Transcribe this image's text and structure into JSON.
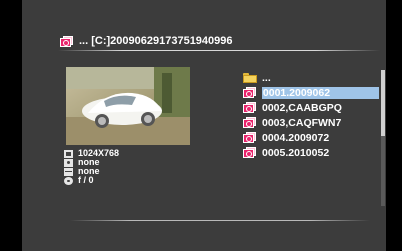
{
  "header": {
    "icon": "photo-icon",
    "path": "... [C:]20090629173751940996"
  },
  "preview": {
    "description_icon": "car-photo-thumbnail"
  },
  "info": {
    "resolution": "1024X768",
    "camera": "none",
    "date": "none",
    "aperture": "f / 0"
  },
  "file_list": {
    "items": [
      {
        "label": "...",
        "icon": "folder-icon",
        "selected": false
      },
      {
        "label": "0001.2009062",
        "icon": "photo-icon",
        "selected": true
      },
      {
        "label": "0002,CAABGPQ",
        "icon": "photo-icon",
        "selected": false
      },
      {
        "label": "0003,CAQFWN7",
        "icon": "photo-icon",
        "selected": false
      },
      {
        "label": "0004.2009072",
        "icon": "photo-icon",
        "selected": false
      },
      {
        "label": "0005.2010052",
        "icon": "photo-icon",
        "selected": false
      }
    ]
  },
  "colors": {
    "background": "#3c3c3c",
    "selection": "#9fc4e8",
    "photo_icon": "#e9246c",
    "text": "#ffffff"
  }
}
